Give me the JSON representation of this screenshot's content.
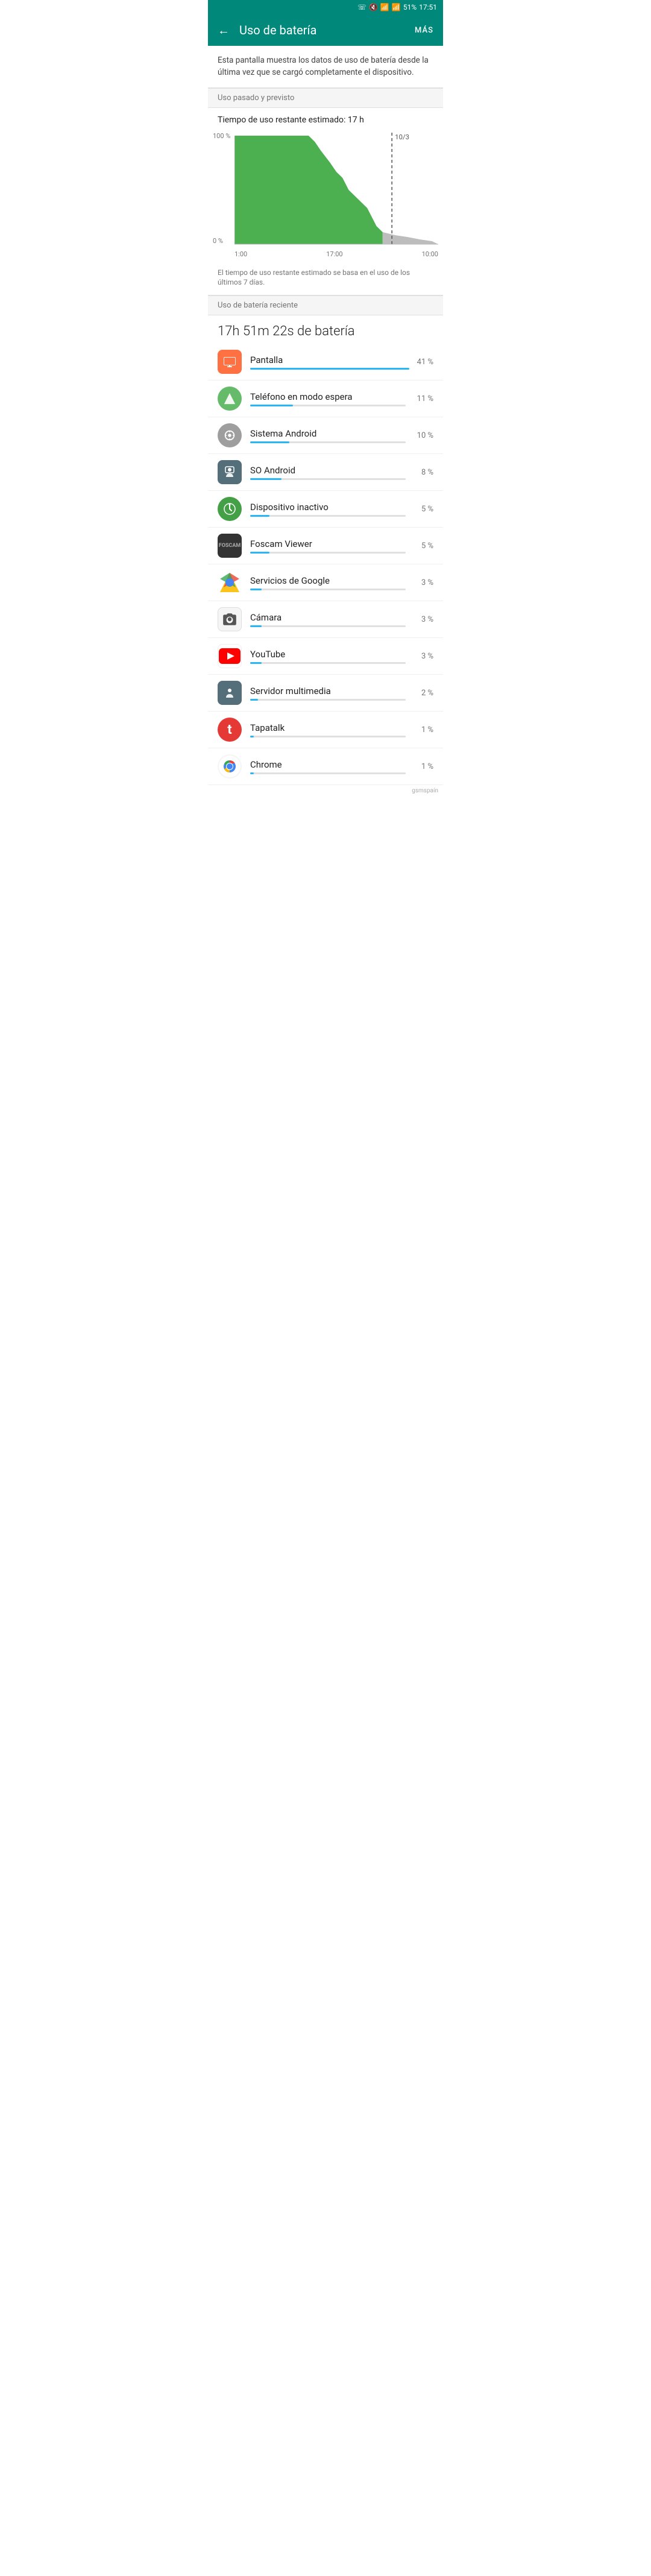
{
  "statusBar": {
    "time": "17:51",
    "battery": "51%",
    "icons": [
      "notification",
      "mute",
      "wifi",
      "signal"
    ]
  },
  "appBar": {
    "title": "Uso de batería",
    "backLabel": "←",
    "moreLabel": "MÁS"
  },
  "infoText": "Esta pantalla muestra los datos de uso de batería desde la última vez que se cargó completamente el dispositivo.",
  "sections": {
    "usoPasado": "Uso pasado y previsto",
    "usoReciente": "Uso de batería reciente"
  },
  "estimatedTime": "Tiempo de uso restante estimado: 17 h",
  "chart": {
    "yLabels": [
      "100 %",
      "0 %"
    ],
    "xLabels": [
      "1:00",
      "17:00",
      "10:00"
    ],
    "topRightLabel": "10/3"
  },
  "noteText": "El tiempo de uso restante estimado se basa en el uso de los últimos 7 días.",
  "batteryTotal": "17h 51m 22s de batería",
  "apps": [
    {
      "name": "Pantalla",
      "percent": "41 %",
      "barWidth": 41,
      "iconType": "pantalla"
    },
    {
      "name": "Teléfono en modo espera",
      "percent": "11 %",
      "barWidth": 11,
      "iconType": "telefono"
    },
    {
      "name": "Sistema Android",
      "percent": "10 %",
      "barWidth": 10,
      "iconType": "sistema"
    },
    {
      "name": "SO Android",
      "percent": "8 %",
      "barWidth": 8,
      "iconType": "so"
    },
    {
      "name": "Dispositivo inactivo",
      "percent": "5 %",
      "barWidth": 5,
      "iconType": "dispositivo"
    },
    {
      "name": "Foscam Viewer",
      "percent": "5 %",
      "barWidth": 5,
      "iconType": "foscam"
    },
    {
      "name": "Servicios de Google",
      "percent": "3 %",
      "barWidth": 3,
      "iconType": "servicios"
    },
    {
      "name": "Cámara",
      "percent": "3 %",
      "barWidth": 3,
      "iconType": "camara"
    },
    {
      "name": "YouTube",
      "percent": "3 %",
      "barWidth": 3,
      "iconType": "youtube"
    },
    {
      "name": "Servidor multimedia",
      "percent": "2 %",
      "barWidth": 2,
      "iconType": "servidor"
    },
    {
      "name": "Tapatalk",
      "percent": "1 %",
      "barWidth": 1,
      "iconType": "tapatalk"
    },
    {
      "name": "Chrome",
      "percent": "1 %",
      "barWidth": 1,
      "iconType": "chrome"
    }
  ]
}
